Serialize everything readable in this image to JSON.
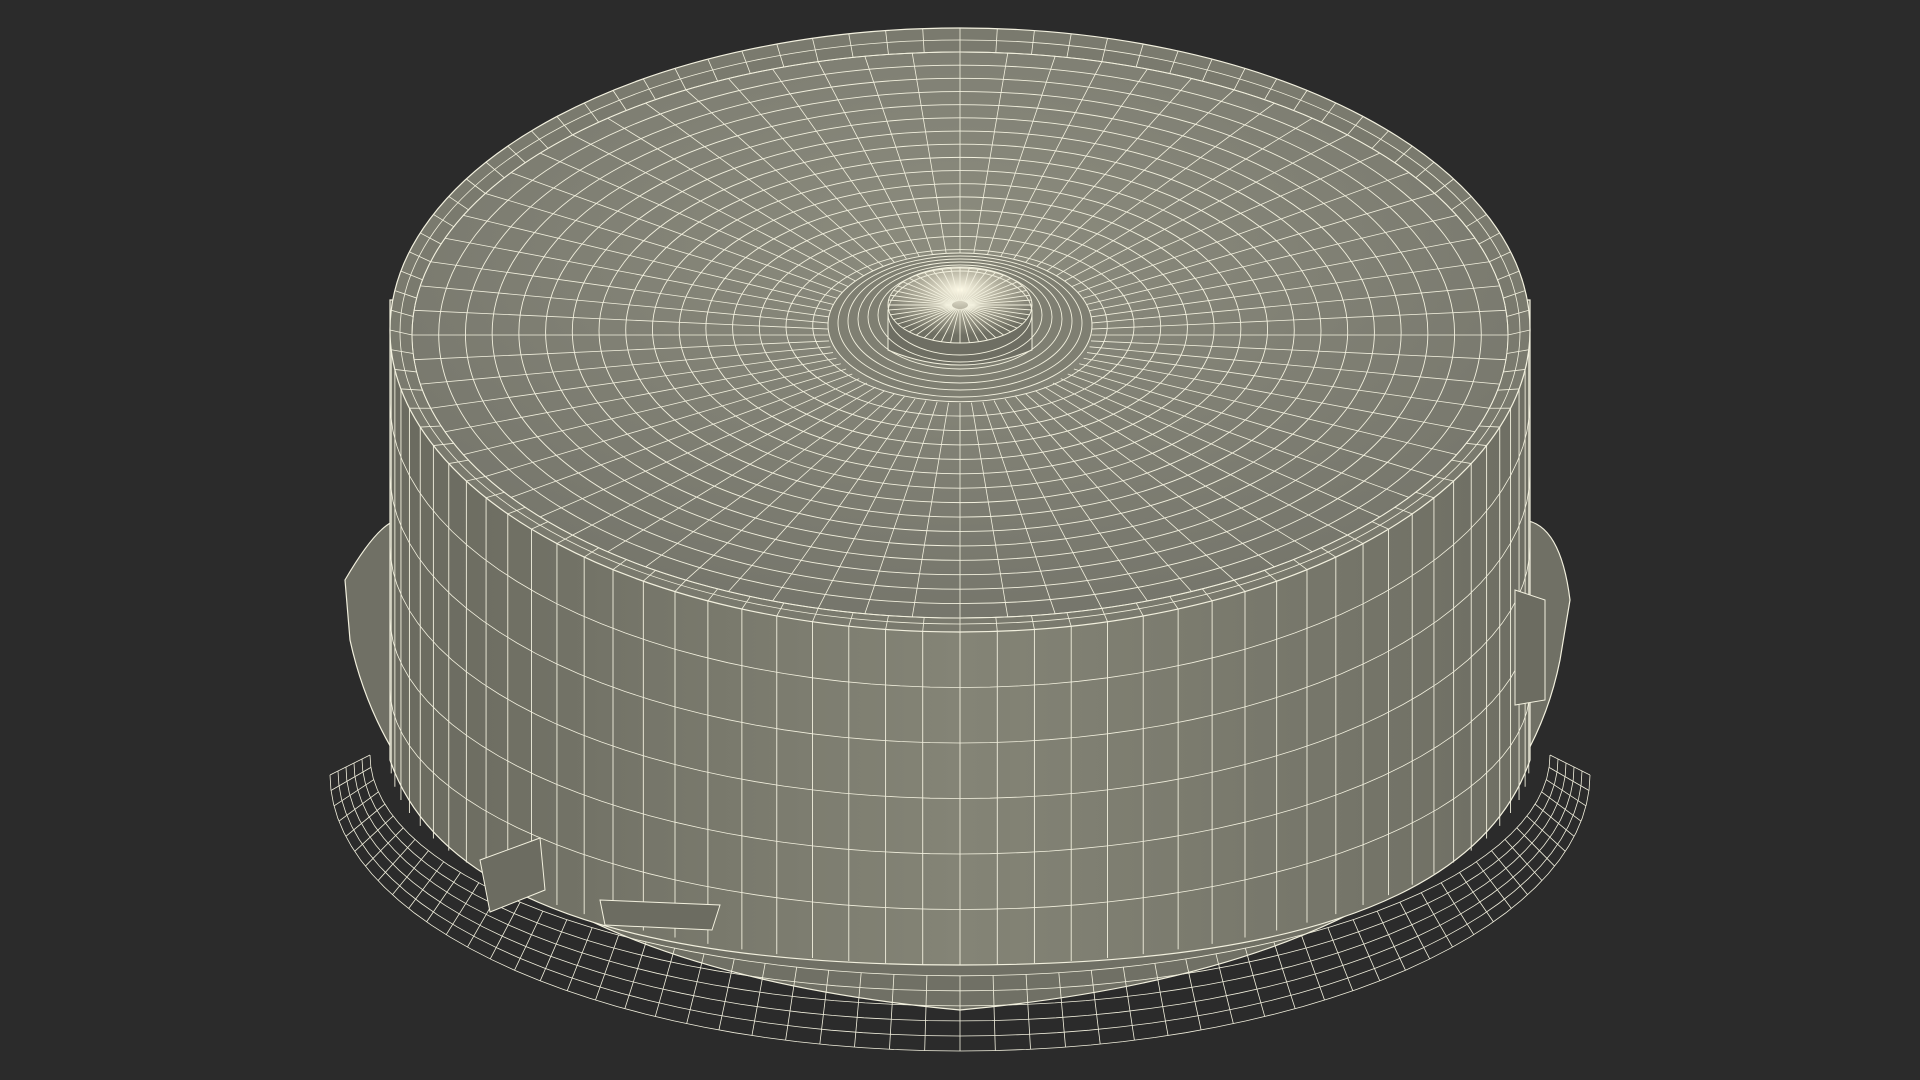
{
  "scene": {
    "subject_icon": "wireframe-cylinder-icon",
    "colors": {
      "background": "#2b2b2b",
      "mesh_fill": "#7d7d6f",
      "mesh_fill_light": "#8f8f81",
      "mesh_fill_dark": "#66665b",
      "wire": "#f2f0de"
    }
  }
}
